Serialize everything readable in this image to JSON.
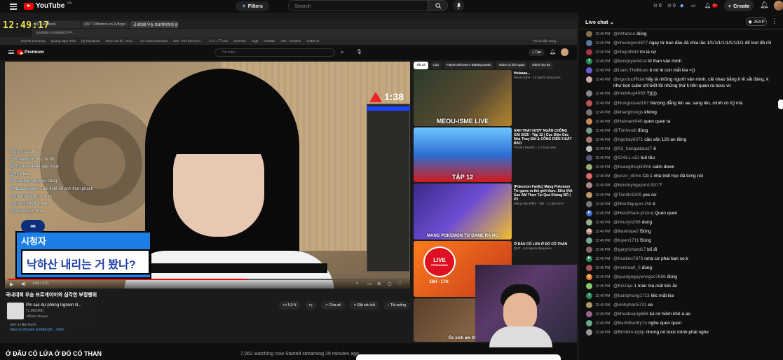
{
  "topbar": {
    "logo": "YouTube",
    "logo_sup": "VN",
    "filters": "Filters",
    "search_placeholder": "Search",
    "badges": [
      "0",
      "0",
      "9+"
    ],
    "create": "Create"
  },
  "overlay": {
    "clock": "12:49:17"
  },
  "browser": {
    "tabs": [
      "(3) Facebook",
      "QNT Cr8tomon on Zyflogo",
      "국내대회 우승 프로게이머의 심각한",
      "",
      "",
      ""
    ],
    "url": "youtube.com/watch?v=...",
    "bookmarks": [
      "PayPal Summary",
      "Quang Ngọc Triệt",
      "(3) Facebook",
      "Drive của tôi - Goo...",
      "Air Antan Collection",
      "dich - Tìm trên Goo...",
      "ジャンプ.com",
      "YouTube",
      "vogit",
      "VietMac",
      "AMI - Timeline",
      "VOEO AI"
    ],
    "right": "Tất cả dấu trang"
  },
  "inner": {
    "premium": "Premium",
    "search_placeholder": "Tìm kiếm",
    "create": "+ Tạo"
  },
  "video": {
    "timer": "1:38",
    "chat_lines": [
      {
        "user": "@dg_232",
        "text": "căng"
      },
      {
        "user": "@vmike6026",
        "text": "nóc đè đỏ"
      },
      {
        "user": "@GDragon4444",
        "text": "gặp ngay"
      },
      {
        "user": "@thuy",
        "text": "bec"
      },
      {
        "user": "@hoanganhnguyen",
        "text": "căng"
      },
      {
        "user": "@Ngoctnguyen",
        "text": "Thôi thiệt đê anh than phạch"
      },
      {
        "user": "@Thiemhoang",
        "text": "bo 4 nv"
      },
      {
        "user": "@quocat2494",
        "text": "3 day"
      },
      {
        "user": "@Dancuoc07",
        "text": "Hey"
      }
    ],
    "sub_label": "시청자",
    "sub_text": "낙하산 내리는 거 봤나?",
    "time": "1:54 / 2:21",
    "title": "국내대회 우승 프로게이머의 심각한 부정행위",
    "actions": [
      "5,9 N",
      "",
      "Chia sẻ",
      "Đặt câu hỏi",
      "Tải xuống"
    ],
    "ad_title": "Pin sạc dự phòng Ugreen N...",
    "ad_price": "₫1,099,000",
    "ad_sub": "Affiliate Shopee",
    "desc1": "xem 1 năm trước",
    "desc2": "https://s.shopee.vn/8AbcdK  ...thêm"
  },
  "suggestions": {
    "chips": [
      "Tất cả",
      "Của",
      "PlayerUnknown's Battlegrounds",
      "Video có liên quan",
      "Dành cho ba"
    ],
    "items": [
      {
        "title": "Holaaaa...",
        "meta": "MeoU-Isme · 13 người đang xem",
        "caption": "MEOU-ISME LIVE"
      },
      {
        "title": "ANH TRAI VƯỢT NGÀN CHÔNG GAI 2025 - Tập 12 | Cục Diện Các Nhà Thay Đổi & CÔNG DIỄN 3 ĐẤT BẢO",
        "meta": "YEAH1 MUSIC · 1 tr lượt xem",
        "caption": "TẬP 12"
      },
      {
        "title": "[Pokemon Fanfic] Mang Pokemon Từ game ra thế giới thực: Siêu Việt Sau ÂM Thực Tại Quả Khủng BỐ | P3",
        "meta": "Mộng Sáu Kiếm · 352 · 11 giờ trước",
        "caption": "MANG POKEMON TỪ GAME RA NG"
      },
      {
        "title": "Ở ĐÂU CÓ LỬA Ở ĐÓ CÓ THAN",
        "meta": "QNT · 6,9 người đang xem",
        "caption": ""
      },
      {
        "title": "",
        "meta": "",
        "caption": "Ốc xích ám thị"
      }
    ],
    "live_logo": "LIVE",
    "live_sub": "STREAMING",
    "live_time": "13H - 17H"
  },
  "bottom": {
    "title": "Ở ĐÂU CÓ LỬA Ở ĐÓ CÓ THAN",
    "watching": "7,062 watching now  Started streaming 29 minutes ago"
  },
  "chat": {
    "title": "Live chat",
    "xp": "25XP",
    "messages": [
      {
        "t": "12:49 PM",
        "u": "@nhfanico",
        "m": "đúng",
        "c": "#8a6d4a",
        "b": ""
      },
      {
        "t": "12:49 PM",
        "u": "@chuongvo4877",
        "m": "ngay từ ban đầu đã chia lão 1/1/1/1/1/1/1/1/1/1 để loot đồ rồi",
        "c": "#5a7a9a",
        "b": ""
      },
      {
        "t": "12:49 PM",
        "u": "@chejs8543",
        "m": "im lá sợ",
        "c": "#a34",
        "b": ""
      },
      {
        "t": "12:49 PM",
        "u": "@tienquyet4414",
        "m": "tố than văn minh",
        "c": "#2b8a5a",
        "b": "T"
      },
      {
        "t": "12:49 PM",
        "u": "@Liam.TheBlues",
        "m": "ê nó lè con mắt kia =))",
        "c": "#6a5acd",
        "b": ""
      },
      {
        "t": "12:49 PM",
        "u": "@ngoctuofficial",
        "m": "hãy là những người văn minh, cãi nhau bằng lí lẽ sắt đáng, k như bọn cube chỉ biết lôi những thứ k liên quan ra toxic vn",
        "c": "#caa",
        "b": ""
      },
      {
        "t": "12:49 PM",
        "u": "@minhhuy4093",
        "m": "?)))))",
        "c": "#888",
        "b": ""
      },
      {
        "t": "12:49 PM",
        "u": "@Hungnosad167",
        "m": "thượng đẳng lên ae, sang lên, mình có IQ mà",
        "c": "#b55",
        "b": ""
      },
      {
        "t": "12:49 PM",
        "u": "@khangtrongs",
        "m": "không",
        "c": "#777",
        "b": ""
      },
      {
        "t": "12:49 PM",
        "u": "@Haimam046",
        "m": "quen quen ta",
        "c": "#c85",
        "b": ""
      },
      {
        "t": "12:49 PM",
        "u": "@Trinhvudi",
        "m": "đúng",
        "c": "#798",
        "b": ""
      },
      {
        "t": "12:49 PM",
        "u": "@ngohay8371",
        "m": "cầu vấn 120 an liềng",
        "c": "#a77",
        "b": ""
      },
      {
        "t": "12:49 PM",
        "u": "@03_trangiabao27",
        "m": "ê",
        "c": "#bbb",
        "b": ""
      },
      {
        "t": "12:49 PM",
        "u": "@CHILL-s5z",
        "m": "tuế tếu",
        "c": "#557",
        "b": ""
      },
      {
        "t": "12:49 PM",
        "u": "@hoangthuylinhhh",
        "m": "calm down",
        "c": "#9a7",
        "b": ""
      },
      {
        "t": "12:49 PM",
        "u": "@enzo_dinho",
        "m": "Có 1 nhà triết học đã từng nói",
        "c": "#d66",
        "b": ""
      },
      {
        "t": "12:49 PM",
        "u": "@tienduynguyen1310",
        "m": "?",
        "c": "#a88",
        "b": ""
      },
      {
        "t": "12:49 PM",
        "u": "@Tienthi1509",
        "m": "yes sơ",
        "c": "#b96",
        "b": ""
      },
      {
        "t": "12:49 PM",
        "u": "@NhutNguyen-Pld",
        "m": "ê",
        "c": "#777",
        "b": ""
      },
      {
        "t": "12:49 PM",
        "u": "@HieuPham-pn2uq",
        "m": "Quen quen",
        "c": "#3a6fd8",
        "b": "H"
      },
      {
        "t": "12:49 PM",
        "u": "@nhuoyn258",
        "m": "dung",
        "c": "#9a8",
        "b": ""
      },
      {
        "t": "12:49 PM",
        "u": "@lilanhope2",
        "m": "Đúng",
        "c": "#b87",
        "b": "#1"
      },
      {
        "t": "12:49 PM",
        "u": "@tuyen1711",
        "m": "Đúng",
        "c": "#7a9",
        "b": ""
      },
      {
        "t": "12:49 PM",
        "u": "@garyrichard17",
        "m": "bố đi",
        "c": "#866",
        "b": ""
      },
      {
        "t": "12:49 PM",
        "u": "@hoatieu7878",
        "m": "nma cơ phai ban so k",
        "c": "#2b8a5a",
        "b": "H"
      },
      {
        "t": "12:49 PM",
        "u": "@minhoa0_0",
        "m": "đúng",
        "c": "#a55",
        "b": ""
      },
      {
        "t": "12:49 PM",
        "u": "@quangnguyenngoc7686",
        "m": "đúng",
        "c": "#e67e22",
        "b": "Q"
      },
      {
        "t": "12:49 PM",
        "u": "@Kizzaje",
        "m": "1 màn mà mất liếc ắc",
        "c": "#8c6",
        "b": ""
      },
      {
        "t": "12:49 PM",
        "u": "@tuanphung1713",
        "m": "liếc mắt kia",
        "c": "#2b8a5a",
        "b": "T"
      },
      {
        "t": "12:49 PM",
        "u": "@vinhphan5731",
        "m": "ee",
        "c": "#a96",
        "b": ""
      },
      {
        "t": "12:49 PM",
        "u": "@khoahoang666",
        "m": "tui nó hiềm khô à ae",
        "c": "#968",
        "b": ""
      },
      {
        "t": "12:49 PM",
        "u": "@BanhBaoKyTu",
        "m": "nghe quen quen",
        "c": "#6a8",
        "b": ""
      },
      {
        "t": "12:49 PM",
        "u": "@Bim8im-kq9p",
        "m": "nhưng nó toxic mình phải nghe",
        "c": "#999",
        "b": ""
      }
    ]
  }
}
